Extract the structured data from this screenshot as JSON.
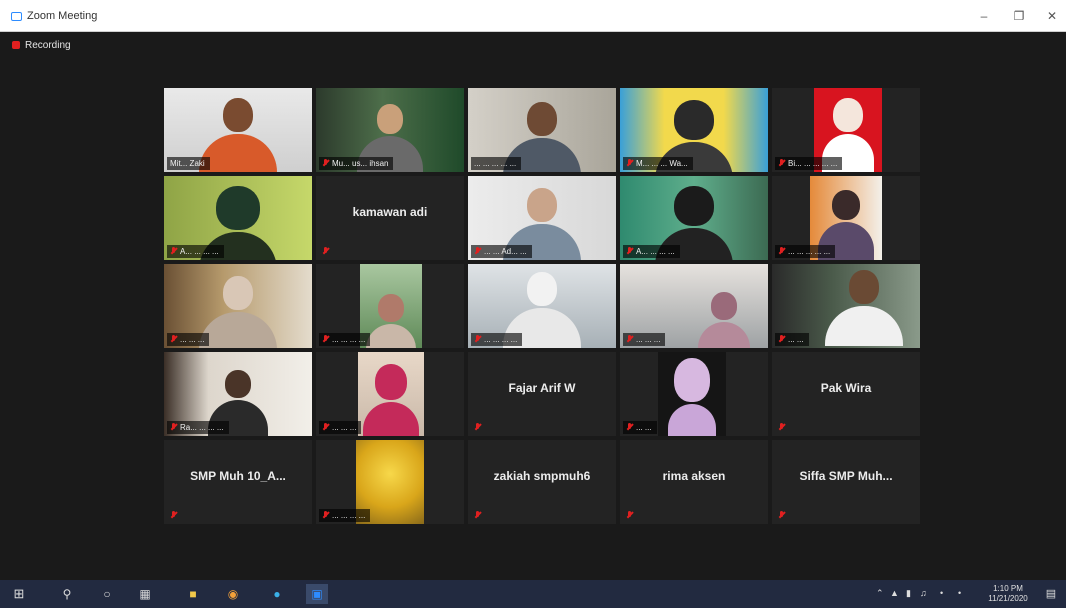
{
  "window": {
    "title": "Zoom Meeting"
  },
  "meeting": {
    "recording_label": "Recording"
  },
  "tiles": [
    {
      "name": "Mit... Zaki",
      "big": ""
    },
    {
      "name": "Mu... us... ihsan",
      "big": ""
    },
    {
      "name": "... ... ... ... ...",
      "big": ""
    },
    {
      "name": "M... ... ... Wa...",
      "big": ""
    },
    {
      "name": "Bi... ... ... ... ...",
      "big": ""
    },
    {
      "name": "A... ... ... ...",
      "big": ""
    },
    {
      "name": "",
      "big": "kamawan adi"
    },
    {
      "name": "... ... Ad... ...",
      "big": ""
    },
    {
      "name": "A... ... ... ...",
      "big": ""
    },
    {
      "name": "... ... ... ... ...",
      "big": ""
    },
    {
      "name": "... ... ...",
      "big": ""
    },
    {
      "name": "... ... ... ...",
      "big": ""
    },
    {
      "name": "... ... ... ...",
      "big": ""
    },
    {
      "name": "... ... ...",
      "big": ""
    },
    {
      "name": "... ...",
      "big": ""
    },
    {
      "name": "Ra... ... ... ...",
      "big": ""
    },
    {
      "name": "... ... ...",
      "big": ""
    },
    {
      "name": "",
      "big": "Fajar Arif W"
    },
    {
      "name": "... ...",
      "big": ""
    },
    {
      "name": "",
      "big": "Pak Wira"
    },
    {
      "name": "",
      "big": "SMP Muh 10_A..."
    },
    {
      "name": "... ... ... ...",
      "big": ""
    },
    {
      "name": "",
      "big": "zakiah smpmuh6"
    },
    {
      "name": "",
      "big": "rima aksen"
    },
    {
      "name": "",
      "big": "Siffa SMP Muh..."
    }
  ],
  "taskbar": {
    "clock_time": "1:10 PM",
    "clock_date": "11/21/2020"
  },
  "colors": {
    "meeting_bg": "#1a1a1a",
    "tile_bg": "#232323",
    "active_border": "#e6d67a",
    "mute_red": "#e02020",
    "taskbar_bg": "#222a40"
  }
}
